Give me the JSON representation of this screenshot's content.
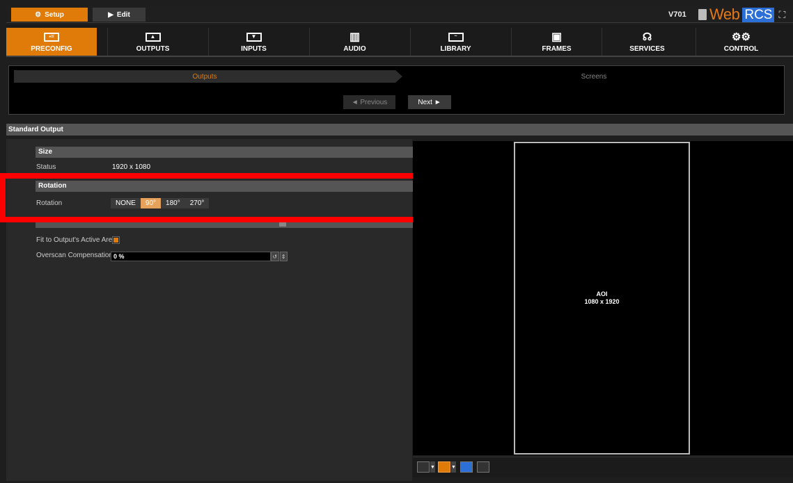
{
  "topbar": {
    "setup_label": "Setup",
    "edit_label": "Edit",
    "version": "V701",
    "logo_web": "Web",
    "logo_rcs": "RCS"
  },
  "nav": {
    "items": [
      {
        "label": "PRECONFIG",
        "icon": "preconfig-icon",
        "active": true
      },
      {
        "label": "OUTPUTS",
        "icon": "outputs-icon"
      },
      {
        "label": "INPUTS",
        "icon": "inputs-icon"
      },
      {
        "label": "AUDIO",
        "icon": "audio-icon"
      },
      {
        "label": "LIBRARY",
        "icon": "library-icon"
      },
      {
        "label": "FRAMES",
        "icon": "frames-icon"
      },
      {
        "label": "SERVICES",
        "icon": "services-icon"
      },
      {
        "label": "CONTROL",
        "icon": "control-icon"
      }
    ]
  },
  "wizard": {
    "step1": "Outputs",
    "step2": "Screens",
    "previous": "◄ Previous",
    "next": "Next ►"
  },
  "section": {
    "title": "Standard Output"
  },
  "form": {
    "size_header": "Size",
    "status_label": "Status",
    "status_value": "1920 x 1080",
    "rotation_header": "Rotation",
    "rotation_label": "Rotation",
    "rotation_options": [
      "NONE",
      "90°",
      "180°",
      "270°"
    ],
    "rotation_selected": "90°",
    "fit_label": "Fit to Output's Active Area",
    "fit_checked": true,
    "overscan_label": "Overscan Compensation",
    "overscan_value": "0 %"
  },
  "preview": {
    "aoi_title": "AOI",
    "aoi_size": "1080 x 1920"
  },
  "colors": {
    "accent": "#e07b0a",
    "highlight": "#ff0000"
  }
}
